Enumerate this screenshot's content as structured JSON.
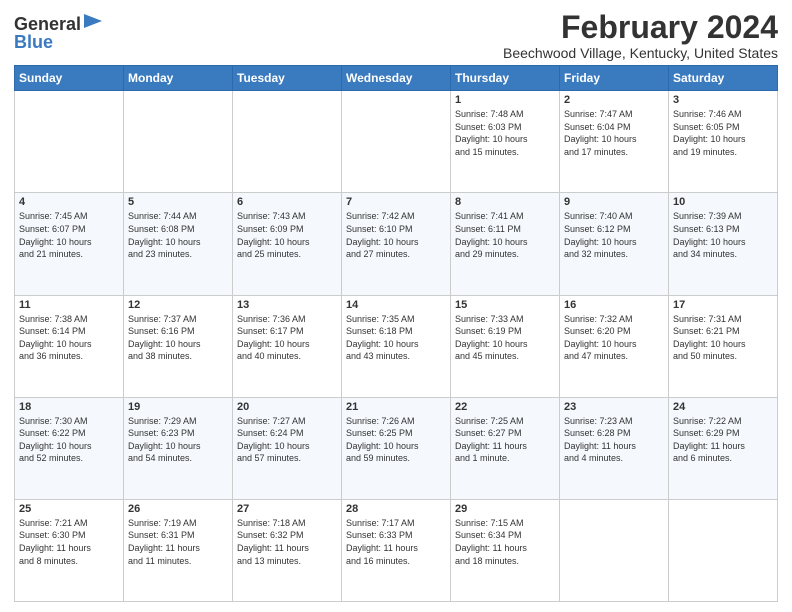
{
  "logo": {
    "general": "General",
    "blue": "Blue"
  },
  "title": "February 2024",
  "subtitle": "Beechwood Village, Kentucky, United States",
  "headers": [
    "Sunday",
    "Monday",
    "Tuesday",
    "Wednesday",
    "Thursday",
    "Friday",
    "Saturday"
  ],
  "weeks": [
    [
      {
        "day": "",
        "info": ""
      },
      {
        "day": "",
        "info": ""
      },
      {
        "day": "",
        "info": ""
      },
      {
        "day": "",
        "info": ""
      },
      {
        "day": "1",
        "info": "Sunrise: 7:48 AM\nSunset: 6:03 PM\nDaylight: 10 hours\nand 15 minutes."
      },
      {
        "day": "2",
        "info": "Sunrise: 7:47 AM\nSunset: 6:04 PM\nDaylight: 10 hours\nand 17 minutes."
      },
      {
        "day": "3",
        "info": "Sunrise: 7:46 AM\nSunset: 6:05 PM\nDaylight: 10 hours\nand 19 minutes."
      }
    ],
    [
      {
        "day": "4",
        "info": "Sunrise: 7:45 AM\nSunset: 6:07 PM\nDaylight: 10 hours\nand 21 minutes."
      },
      {
        "day": "5",
        "info": "Sunrise: 7:44 AM\nSunset: 6:08 PM\nDaylight: 10 hours\nand 23 minutes."
      },
      {
        "day": "6",
        "info": "Sunrise: 7:43 AM\nSunset: 6:09 PM\nDaylight: 10 hours\nand 25 minutes."
      },
      {
        "day": "7",
        "info": "Sunrise: 7:42 AM\nSunset: 6:10 PM\nDaylight: 10 hours\nand 27 minutes."
      },
      {
        "day": "8",
        "info": "Sunrise: 7:41 AM\nSunset: 6:11 PM\nDaylight: 10 hours\nand 29 minutes."
      },
      {
        "day": "9",
        "info": "Sunrise: 7:40 AM\nSunset: 6:12 PM\nDaylight: 10 hours\nand 32 minutes."
      },
      {
        "day": "10",
        "info": "Sunrise: 7:39 AM\nSunset: 6:13 PM\nDaylight: 10 hours\nand 34 minutes."
      }
    ],
    [
      {
        "day": "11",
        "info": "Sunrise: 7:38 AM\nSunset: 6:14 PM\nDaylight: 10 hours\nand 36 minutes."
      },
      {
        "day": "12",
        "info": "Sunrise: 7:37 AM\nSunset: 6:16 PM\nDaylight: 10 hours\nand 38 minutes."
      },
      {
        "day": "13",
        "info": "Sunrise: 7:36 AM\nSunset: 6:17 PM\nDaylight: 10 hours\nand 40 minutes."
      },
      {
        "day": "14",
        "info": "Sunrise: 7:35 AM\nSunset: 6:18 PM\nDaylight: 10 hours\nand 43 minutes."
      },
      {
        "day": "15",
        "info": "Sunrise: 7:33 AM\nSunset: 6:19 PM\nDaylight: 10 hours\nand 45 minutes."
      },
      {
        "day": "16",
        "info": "Sunrise: 7:32 AM\nSunset: 6:20 PM\nDaylight: 10 hours\nand 47 minutes."
      },
      {
        "day": "17",
        "info": "Sunrise: 7:31 AM\nSunset: 6:21 PM\nDaylight: 10 hours\nand 50 minutes."
      }
    ],
    [
      {
        "day": "18",
        "info": "Sunrise: 7:30 AM\nSunset: 6:22 PM\nDaylight: 10 hours\nand 52 minutes."
      },
      {
        "day": "19",
        "info": "Sunrise: 7:29 AM\nSunset: 6:23 PM\nDaylight: 10 hours\nand 54 minutes."
      },
      {
        "day": "20",
        "info": "Sunrise: 7:27 AM\nSunset: 6:24 PM\nDaylight: 10 hours\nand 57 minutes."
      },
      {
        "day": "21",
        "info": "Sunrise: 7:26 AM\nSunset: 6:25 PM\nDaylight: 10 hours\nand 59 minutes."
      },
      {
        "day": "22",
        "info": "Sunrise: 7:25 AM\nSunset: 6:27 PM\nDaylight: 11 hours\nand 1 minute."
      },
      {
        "day": "23",
        "info": "Sunrise: 7:23 AM\nSunset: 6:28 PM\nDaylight: 11 hours\nand 4 minutes."
      },
      {
        "day": "24",
        "info": "Sunrise: 7:22 AM\nSunset: 6:29 PM\nDaylight: 11 hours\nand 6 minutes."
      }
    ],
    [
      {
        "day": "25",
        "info": "Sunrise: 7:21 AM\nSunset: 6:30 PM\nDaylight: 11 hours\nand 8 minutes."
      },
      {
        "day": "26",
        "info": "Sunrise: 7:19 AM\nSunset: 6:31 PM\nDaylight: 11 hours\nand 11 minutes."
      },
      {
        "day": "27",
        "info": "Sunrise: 7:18 AM\nSunset: 6:32 PM\nDaylight: 11 hours\nand 13 minutes."
      },
      {
        "day": "28",
        "info": "Sunrise: 7:17 AM\nSunset: 6:33 PM\nDaylight: 11 hours\nand 16 minutes."
      },
      {
        "day": "29",
        "info": "Sunrise: 7:15 AM\nSunset: 6:34 PM\nDaylight: 11 hours\nand 18 minutes."
      },
      {
        "day": "",
        "info": ""
      },
      {
        "day": "",
        "info": ""
      }
    ]
  ]
}
